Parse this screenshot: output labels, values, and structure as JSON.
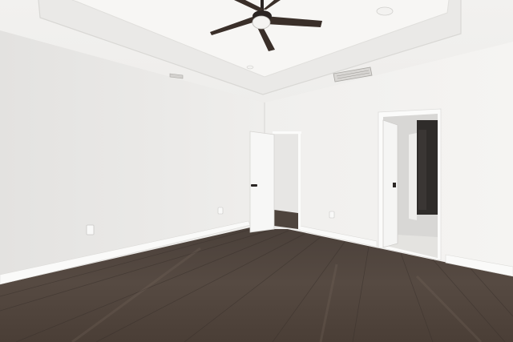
{
  "scene": {
    "subject": "empty-room",
    "colors": {
      "wall_left": "#ecebe9",
      "wall_right": "#f2f1ef",
      "ceiling": "#f4f3f1",
      "tray": "#f8f7f5",
      "floor_dark": "#3b342f",
      "floor_mid": "#564b43",
      "floor_light": "#6b5e55",
      "baseboard": "#fbfbfa",
      "fan_blade": "#3a2f29",
      "fan_housing": "#2b2523",
      "door": "#f6f6f5",
      "hallway": "#d9d8d6",
      "hallway_floor": "#e6e5e2",
      "dark_room": "#2e2c2b"
    },
    "icons": [
      "ceiling-fan-icon",
      "air-vent-icon",
      "electrical-outlet-icon",
      "door-handle-icon"
    ]
  }
}
